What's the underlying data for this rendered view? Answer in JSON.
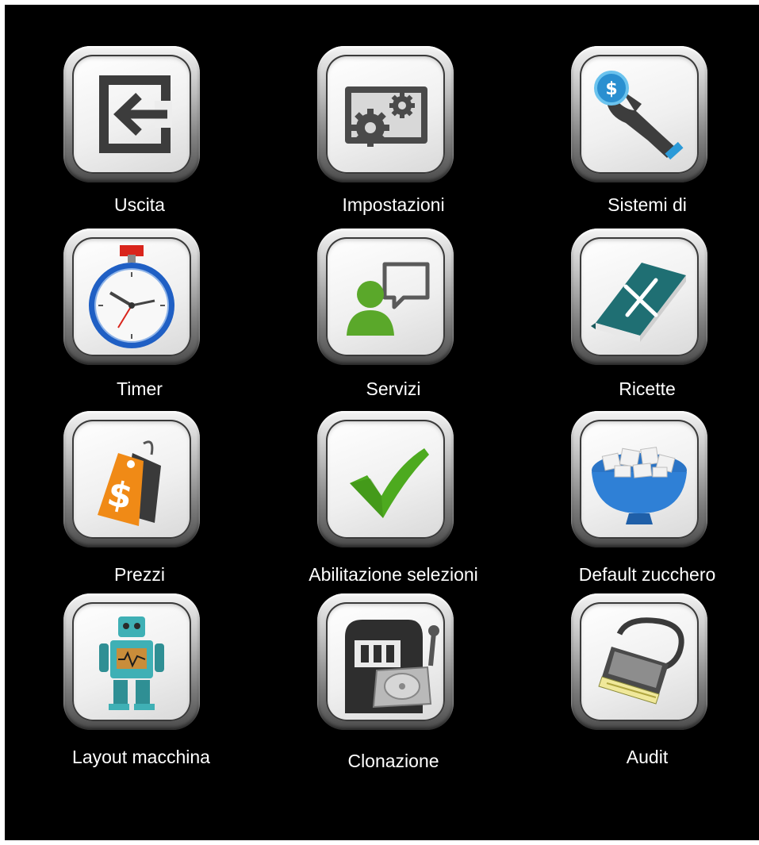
{
  "menu": {
    "items": [
      {
        "label": "Uscita",
        "icon": "exit-icon"
      },
      {
        "label": "Impostazioni",
        "icon": "settings-gears-icon"
      },
      {
        "label": "Sistemi di",
        "icon": "payment-coin-hand-icon"
      },
      {
        "label": "Timer",
        "icon": "stopwatch-icon"
      },
      {
        "label": "Servizi",
        "icon": "service-user-chat-icon"
      },
      {
        "label": "Ricette",
        "icon": "recipe-book-icon"
      },
      {
        "label": "Prezzi",
        "icon": "price-tag-icon"
      },
      {
        "label": "Abilitazione selezioni",
        "icon": "checkmark-icon"
      },
      {
        "label": "Default zucchero",
        "icon": "sugar-bowl-icon"
      },
      {
        "label": "Layout macchina",
        "icon": "robot-icon"
      },
      {
        "label": "Clonazione",
        "icon": "clone-harddisk-icon"
      },
      {
        "label": "Audit",
        "icon": "audit-cable-icon"
      }
    ]
  },
  "colors": {
    "background": "#000000",
    "label": "#ffffff",
    "frame": "#8a8a8a"
  }
}
